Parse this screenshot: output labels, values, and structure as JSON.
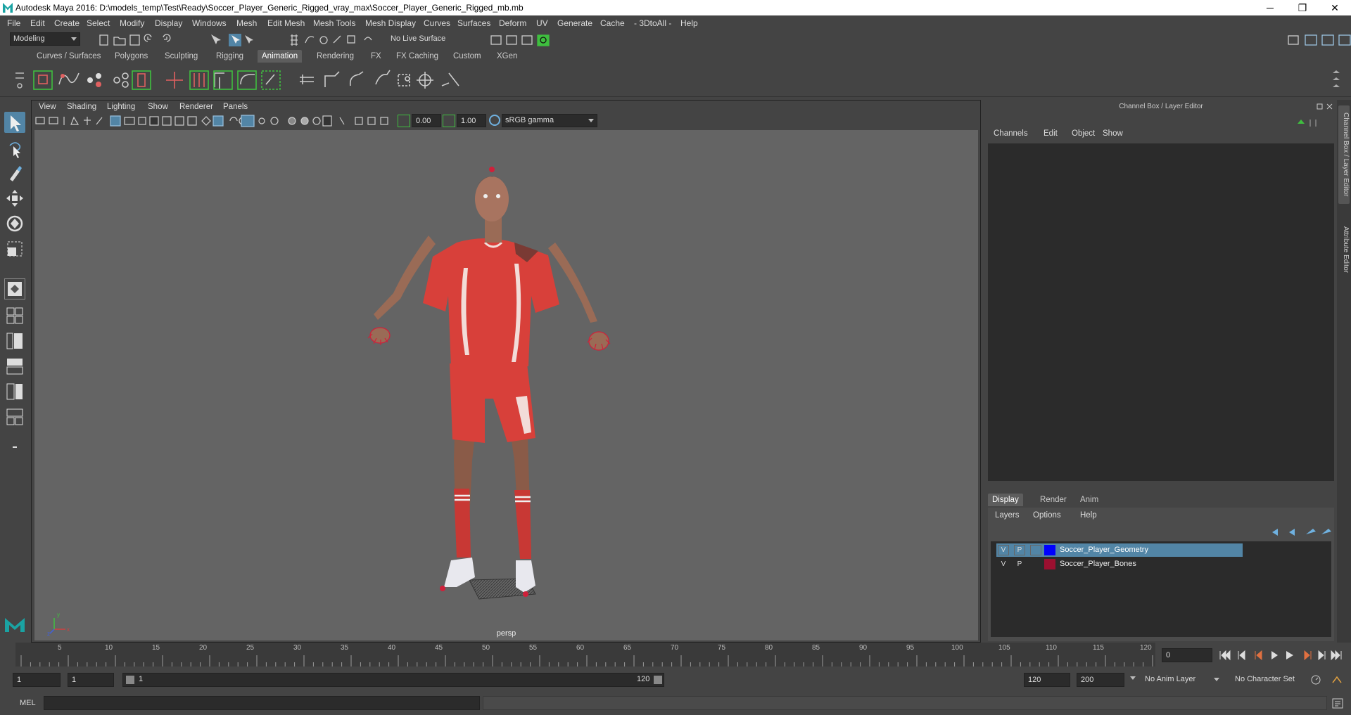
{
  "window": {
    "title": "Autodesk Maya 2016: D:\\models_temp\\Test\\Ready\\Soccer_Player_Generic_Rigged_vray_max\\Soccer_Player_Generic_Rigged_mb.mb",
    "minimize_glyph": "─",
    "restore_glyph": "❐",
    "close_glyph": "✕"
  },
  "menubar": [
    "File",
    "Edit",
    "Create",
    "Select",
    "Modify",
    "Display",
    "Windows",
    "Mesh",
    "Edit Mesh",
    "Mesh Tools",
    "Mesh Display",
    "Curves",
    "Surfaces",
    "Deform",
    "UV",
    "Generate",
    "Cache",
    "- 3DtoAll -",
    "Help"
  ],
  "statusline": {
    "mode": "Modeling",
    "live_surface": "No Live Surface"
  },
  "shelf_tabs": [
    "Curves / Surfaces",
    "Polygons",
    "Sculpting",
    "Rigging",
    "Animation",
    "Rendering",
    "FX",
    "FX Caching",
    "Custom",
    "XGen"
  ],
  "active_shelf_tab": "Animation",
  "panel_menu": [
    "View",
    "Shading",
    "Lighting",
    "Show",
    "Renderer",
    "Panels"
  ],
  "panel_toolbar": {
    "exposure": "0.00",
    "gamma": "1.00",
    "color_space": "sRGB gamma"
  },
  "viewport": {
    "camera_label": "persp",
    "axis_x": "x",
    "axis_y": "y",
    "axis_z": "z"
  },
  "channel_box": {
    "header": "Channel Box / Layer Editor",
    "menu": [
      "Channels",
      "Edit",
      "Object",
      "Show"
    ]
  },
  "layer_editor": {
    "tabs": [
      "Display",
      "Render",
      "Anim"
    ],
    "active_tab": "Display",
    "menu": [
      "Layers",
      "Options",
      "Help"
    ],
    "layers": [
      {
        "v": "V",
        "p": "P",
        "name": "Soccer_Player_Geometry",
        "color": "#0000ff",
        "selected": true
      },
      {
        "v": "V",
        "p": "P",
        "name": "Soccer_Player_Bones",
        "color": "#9b1030",
        "selected": false
      }
    ]
  },
  "side_tabs": [
    "Channel Box / Layer Editor",
    "Attribute Editor"
  ],
  "time_slider": {
    "ticks": [
      "5",
      "10",
      "15",
      "20",
      "25",
      "30",
      "35",
      "40",
      "45",
      "50",
      "55",
      "60",
      "65",
      "70",
      "75",
      "80",
      "85",
      "90",
      "95",
      "100",
      "105",
      "110",
      "115",
      "120"
    ],
    "current_frame": "0"
  },
  "range_slider": {
    "start_time": "1",
    "playback_start": "1",
    "range_start_label": "1",
    "range_end_label": "120",
    "playback_end": "120",
    "end_time": "200",
    "anim_layer": "No Anim Layer",
    "character_set": "No Character Set"
  },
  "command_line": {
    "label": "MEL"
  },
  "colors": {
    "accent_blue": "#5285a6",
    "shelf_green": "#3fbf3f",
    "selection_red": "#d0203a"
  }
}
